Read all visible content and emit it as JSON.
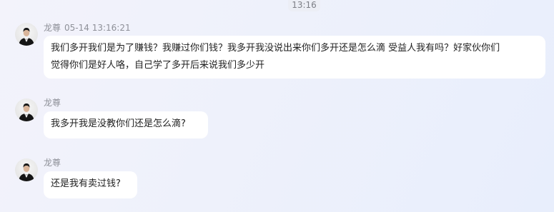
{
  "divider_time": "13:16",
  "messages": [
    {
      "sender": "龙尊",
      "timestamp": "05-14 13:16:21",
      "lines": [
        "我们多开我们是为了赚钱？我赚过你们钱？我多开我没说出来你们多开还是怎么滴 受益人我有吗？好家伙你们",
        "觉得你们是好人咯，自己学了多开后来说我们多少开"
      ]
    },
    {
      "sender": "龙尊",
      "timestamp": "",
      "lines": [
        "我多开我是没教你们还是怎么滴?"
      ]
    },
    {
      "sender": "龙尊",
      "timestamp": "",
      "lines": [
        "还是我有卖过钱?"
      ]
    }
  ]
}
